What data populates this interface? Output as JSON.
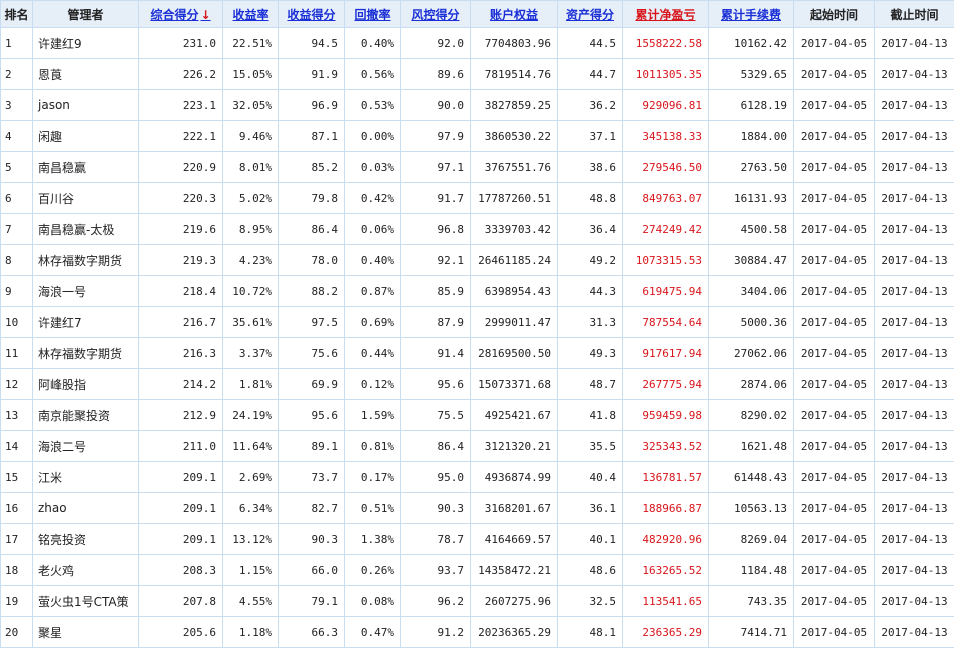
{
  "columns": [
    {
      "key": "rank",
      "label": "排名",
      "sortable": false,
      "cls": "rank"
    },
    {
      "key": "manager",
      "label": "管理者",
      "sortable": false,
      "cls": "mgr"
    },
    {
      "key": "total",
      "label": "综合得分",
      "sortable": true,
      "sorted": true,
      "cls": ""
    },
    {
      "key": "return",
      "label": "收益率",
      "sortable": true,
      "cls": ""
    },
    {
      "key": "return_score",
      "label": "收益得分",
      "sortable": true,
      "cls": ""
    },
    {
      "key": "drawdown",
      "label": "回撤率",
      "sortable": true,
      "cls": ""
    },
    {
      "key": "risk_score",
      "label": "风控得分",
      "sortable": true,
      "cls": ""
    },
    {
      "key": "equity",
      "label": "账户权益",
      "sortable": true,
      "cls": ""
    },
    {
      "key": "asset_score",
      "label": "资产得分",
      "sortable": true,
      "cls": ""
    },
    {
      "key": "pnl",
      "label": "累计净盈亏",
      "sortable": true,
      "red": true,
      "cls": "pnl"
    },
    {
      "key": "fee",
      "label": "累计手续费",
      "sortable": true,
      "cls": ""
    },
    {
      "key": "start",
      "label": "起始时间",
      "sortable": false,
      "cls": "date"
    },
    {
      "key": "end",
      "label": "截止时间",
      "sortable": false,
      "cls": "date"
    }
  ],
  "sort_indicator": "↓",
  "rows": [
    [
      "1",
      "许建红9",
      "231.0",
      "22.51%",
      "94.5",
      "0.40%",
      "92.0",
      "7704803.96",
      "44.5",
      "1558222.58",
      "10162.42",
      "2017-04-05",
      "2017-04-13"
    ],
    [
      "2",
      "恩莨",
      "226.2",
      "15.05%",
      "91.9",
      "0.56%",
      "89.6",
      "7819514.76",
      "44.7",
      "1011305.35",
      "5329.65",
      "2017-04-05",
      "2017-04-13"
    ],
    [
      "3",
      "jason",
      "223.1",
      "32.05%",
      "96.9",
      "0.53%",
      "90.0",
      "3827859.25",
      "36.2",
      "929096.81",
      "6128.19",
      "2017-04-05",
      "2017-04-13"
    ],
    [
      "4",
      "闲趣",
      "222.1",
      "9.46%",
      "87.1",
      "0.00%",
      "97.9",
      "3860530.22",
      "37.1",
      "345138.33",
      "1884.00",
      "2017-04-05",
      "2017-04-13"
    ],
    [
      "5",
      "南昌稳赢",
      "220.9",
      "8.01%",
      "85.2",
      "0.03%",
      "97.1",
      "3767551.76",
      "38.6",
      "279546.50",
      "2763.50",
      "2017-04-05",
      "2017-04-13"
    ],
    [
      "6",
      "百川谷",
      "220.3",
      "5.02%",
      "79.8",
      "0.42%",
      "91.7",
      "17787260.51",
      "48.8",
      "849763.07",
      "16131.93",
      "2017-04-05",
      "2017-04-13"
    ],
    [
      "7",
      "南昌稳赢-太极",
      "219.6",
      "8.95%",
      "86.4",
      "0.06%",
      "96.8",
      "3339703.42",
      "36.4",
      "274249.42",
      "4500.58",
      "2017-04-05",
      "2017-04-13"
    ],
    [
      "8",
      "林存福数字期货",
      "219.3",
      "4.23%",
      "78.0",
      "0.40%",
      "92.1",
      "26461185.24",
      "49.2",
      "1073315.53",
      "30884.47",
      "2017-04-05",
      "2017-04-13"
    ],
    [
      "9",
      "海浪一号",
      "218.4",
      "10.72%",
      "88.2",
      "0.87%",
      "85.9",
      "6398954.43",
      "44.3",
      "619475.94",
      "3404.06",
      "2017-04-05",
      "2017-04-13"
    ],
    [
      "10",
      "许建红7",
      "216.7",
      "35.61%",
      "97.5",
      "0.69%",
      "87.9",
      "2999011.47",
      "31.3",
      "787554.64",
      "5000.36",
      "2017-04-05",
      "2017-04-13"
    ],
    [
      "11",
      "林存福数字期货",
      "216.3",
      "3.37%",
      "75.6",
      "0.44%",
      "91.4",
      "28169500.50",
      "49.3",
      "917617.94",
      "27062.06",
      "2017-04-05",
      "2017-04-13"
    ],
    [
      "12",
      "阿峰股指",
      "214.2",
      "1.81%",
      "69.9",
      "0.12%",
      "95.6",
      "15073371.68",
      "48.7",
      "267775.94",
      "2874.06",
      "2017-04-05",
      "2017-04-13"
    ],
    [
      "13",
      "南京能聚投资",
      "212.9",
      "24.19%",
      "95.6",
      "1.59%",
      "75.5",
      "4925421.67",
      "41.8",
      "959459.98",
      "8290.02",
      "2017-04-05",
      "2017-04-13"
    ],
    [
      "14",
      "海浪二号",
      "211.0",
      "11.64%",
      "89.1",
      "0.81%",
      "86.4",
      "3121320.21",
      "35.5",
      "325343.52",
      "1621.48",
      "2017-04-05",
      "2017-04-13"
    ],
    [
      "15",
      "江米",
      "209.1",
      "2.69%",
      "73.7",
      "0.17%",
      "95.0",
      "4936874.99",
      "40.4",
      "136781.57",
      "61448.43",
      "2017-04-05",
      "2017-04-13"
    ],
    [
      "16",
      "zhao",
      "209.1",
      "6.34%",
      "82.7",
      "0.51%",
      "90.3",
      "3168201.67",
      "36.1",
      "188966.87",
      "10563.13",
      "2017-04-05",
      "2017-04-13"
    ],
    [
      "17",
      "铭亮投资",
      "209.1",
      "13.12%",
      "90.3",
      "1.38%",
      "78.7",
      "4164669.57",
      "40.1",
      "482920.96",
      "8269.04",
      "2017-04-05",
      "2017-04-13"
    ],
    [
      "18",
      "老火鸡",
      "208.3",
      "1.15%",
      "66.0",
      "0.26%",
      "93.7",
      "14358472.21",
      "48.6",
      "163265.52",
      "1184.48",
      "2017-04-05",
      "2017-04-13"
    ],
    [
      "19",
      "萤火虫1号CTA策",
      "207.8",
      "4.55%",
      "79.1",
      "0.08%",
      "96.2",
      "2607275.96",
      "32.5",
      "113541.65",
      "743.35",
      "2017-04-05",
      "2017-04-13"
    ],
    [
      "20",
      "聚星",
      "205.6",
      "1.18%",
      "66.3",
      "0.47%",
      "91.2",
      "20236365.29",
      "48.1",
      "236365.29",
      "7414.71",
      "2017-04-05",
      "2017-04-13"
    ]
  ],
  "colors": {
    "link": "#1a2fd6",
    "negative_pnl": "#d8151b",
    "header_bg": "#e6eef8",
    "border": "#c9ddf0"
  }
}
